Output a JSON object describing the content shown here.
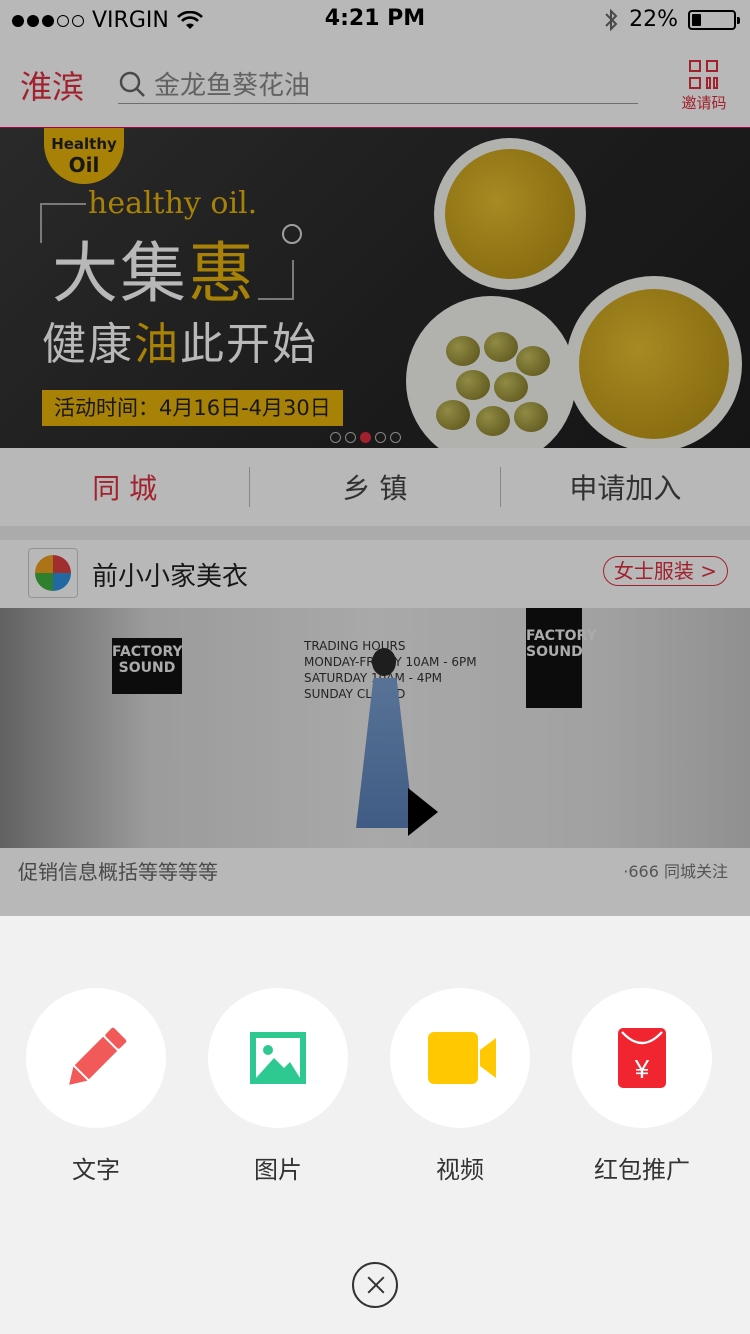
{
  "status_bar": {
    "carrier": "VIRGIN",
    "time": "4:21 PM",
    "battery": "22%",
    "battery_level": 0.22,
    "signal_bars_filled": 3,
    "signal_bars_total": 5
  },
  "header": {
    "city": "淮滨",
    "search_placeholder": "金龙鱼葵花油",
    "invite_label": "邀请码"
  },
  "banner": {
    "logo_top": "Healthy",
    "logo_bottom": "Oil",
    "brand_sub": "healthy oil.",
    "title_a": "大集",
    "title_b": "惠",
    "slogan_a": "健康",
    "slogan_b": "油",
    "slogan_c": "此开始",
    "date_text": "活动时间：4月16日-4月30日",
    "page_count": 5,
    "active_page": 3
  },
  "tabs": [
    {
      "label": "同 城",
      "active": true
    },
    {
      "label": "乡 镇",
      "active": false
    },
    {
      "label": "申请加入",
      "active": false
    }
  ],
  "store": {
    "name": "前小小家美衣",
    "category_tag": "女士服装 >"
  },
  "feed": {
    "sign_factory": "FACTORY SOUND",
    "trading_hours": [
      "TRADING HOURS",
      "MONDAY-FRIDAY  10AM - 6PM",
      "SATURDAY  10AM - 4PM",
      "SUNDAY  CLOSED"
    ],
    "description": "促销信息概括等等等等",
    "followers": "·666 同城关注"
  },
  "actions": [
    {
      "label": "文字",
      "icon": "pencil-icon",
      "color": "#f25a5a"
    },
    {
      "label": "图片",
      "icon": "image-icon",
      "color": "#2ec990"
    },
    {
      "label": "视频",
      "icon": "video-camera-icon",
      "color": "#ffc800"
    },
    {
      "label": "红包推广",
      "icon": "red-packet-icon",
      "color": "#f0252f"
    }
  ],
  "colors": {
    "accent": "#e03040",
    "sheet_bg": "#f1f1f1"
  }
}
